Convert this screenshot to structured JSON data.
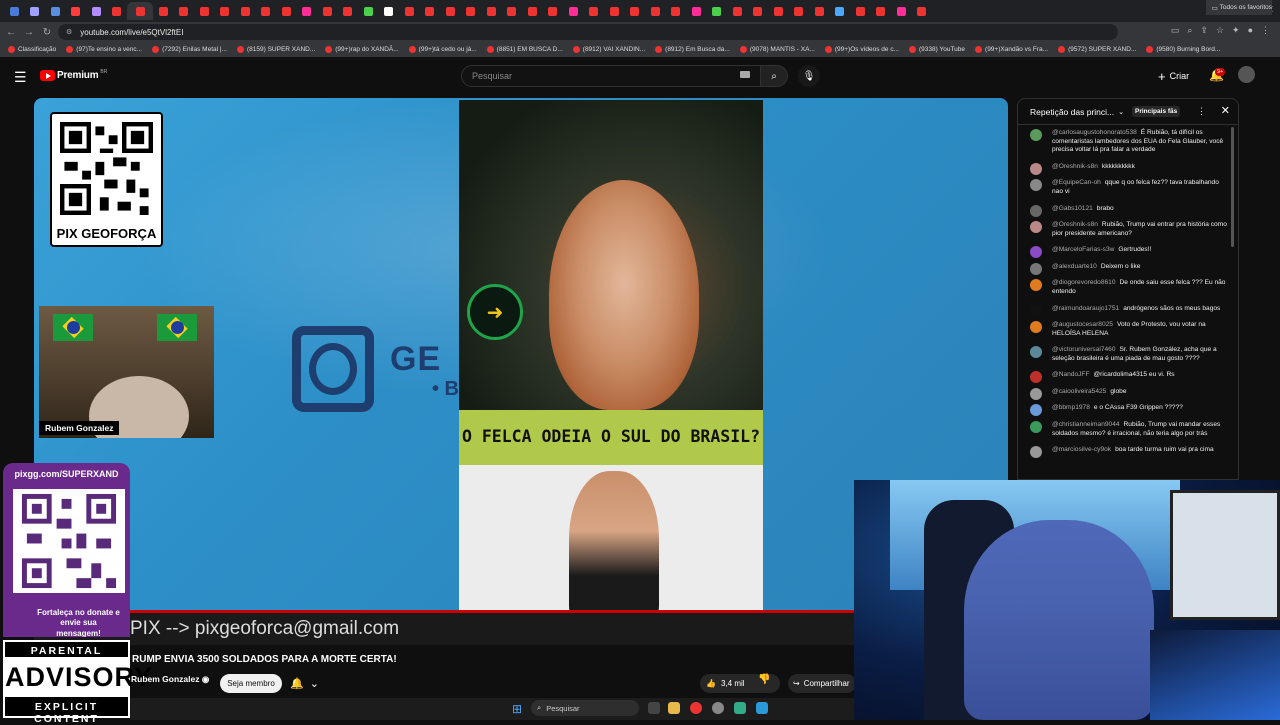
{
  "browser": {
    "url": "youtube.com/live/e5QtVl2ftEI",
    "tab_colors": [
      "#4a7bd8",
      "#a0a0ff",
      "#5a8ee0",
      "#ff3b3b",
      "#b38cff",
      "#e33",
      "#e33",
      "#e33",
      "#e33",
      "#e33",
      "#e33",
      "#e33",
      "#e33",
      "#e33",
      "#ff2d95",
      "#e33",
      "#e33",
      "#4ccf4c",
      "#ffffff",
      "#e33",
      "#e33",
      "#e33",
      "#e33",
      "#e33",
      "#e33",
      "#e33",
      "#e33",
      "#ff2d95",
      "#e33",
      "#e33",
      "#e33",
      "#e33",
      "#e33",
      "#ff2d95",
      "#4ccf4c",
      "#e33",
      "#e33",
      "#e33",
      "#e33",
      "#e33",
      "#4aa8ff",
      "#e33",
      "#e33",
      "#ff2d95",
      "#e33"
    ],
    "bookmarks": [
      "Classificação",
      "(97)Te ensino a venc...",
      "(7292) Enilas Metal |...",
      "(8159) SUPER XAND...",
      "(99+)rap do XANDÃ...",
      "(99+)tá cedo ou já...",
      "(8851) EM BUSCA D...",
      "(8912) VAI XANDIN...",
      "(8912) Em Busca da...",
      "(9078) MANTIS - XA...",
      "(99+)Os vídeos de c...",
      "(9338) YouTube",
      "(99+)Xandão vs Fra...",
      "(9572) SUPER XAND...",
      "(9580) Burning Bord..."
    ],
    "bookmarks_all": "Todos os favoritos"
  },
  "header": {
    "logo_text": "Premium",
    "logo_region": "BR",
    "search_placeholder": "Pesquisar",
    "create_label": "Criar",
    "notif_count": "9+"
  },
  "player": {
    "qr_caption": "PIX GEOFORÇA",
    "brand_text": "GE",
    "brand_sub": "• B",
    "webcam_name": "Rubem Gonzalez",
    "video_caption": "O FELCA ODEIA O SUL DO BRASIL?",
    "pix_line": "PIX --> pixgeoforca@gmail.com",
    "pix_line_prefix": "PIX"
  },
  "donate": {
    "url": "pixgg.com/SUPERXAND",
    "message": "Fortaleça no donate e envie sua mensagem!"
  },
  "advisory": {
    "top": "PARENTAL",
    "middle": "ADVISORY",
    "bottom": "EXPLICIT CONTENT"
  },
  "video": {
    "title": "RUMP ENVIA 3500 SOLDADOS PARA A MORTE CERTA!",
    "channel": "Rubem Gonzalez",
    "join_label": "Seja membro",
    "likes": "3,4 mil",
    "share_label": "Compartilhar"
  },
  "chat": {
    "title": "Repetição das princi...",
    "tag": "Principais fãs",
    "messages": [
      {
        "user": "@carlosaugustohonorato538",
        "text": "É Rubião, tá difícil os comentaristas lambedores dos EUA do Fela Glauber, você precisa voltar lá pra falar a verdade",
        "color": "#5a9a5a"
      },
      {
        "user": "@Oreshnik-s8n",
        "text": "kkkkkkkkkk",
        "color": "#b88"
      },
      {
        "user": "@EquipeCan-oh",
        "text": "qque q oo felca fez?? tava trabalhando nao vi",
        "color": "#888"
      },
      {
        "user": "@Gabs10121",
        "text": "brabo",
        "color": "#666"
      },
      {
        "user": "@Oreshnik-s8n",
        "text": "Rubião, Trump vai entrar pra história como pior presidente americano?",
        "color": "#b88"
      },
      {
        "user": "@MarceloFarias-s3w",
        "text": "Gertrudes!!",
        "color": "#8b4bc8"
      },
      {
        "user": "@alexduarte10",
        "text": "Deixem o like",
        "color": "#777"
      },
      {
        "user": "@diogorevoredo8610",
        "text": "De onde saiu esse felca ??? Eu não entendo",
        "color": "#e07b20"
      },
      {
        "user": "@raimundoaraujo1751",
        "text": "andrógenos sãos os meus bagos",
        "color": "#111"
      },
      {
        "user": "@augustocesar8025",
        "text": "Voto de Protesto, vou votar na HELOÍSA HELENA",
        "color": "#e07b20"
      },
      {
        "user": "@victoruniversal7460",
        "text": "Sr. Rubem González, acha que a seleção brasileira é uma piada de mau gosto ????",
        "color": "#5a8a9a"
      },
      {
        "user": "@NandoJFF",
        "text": "@ricardolima4315 eu vi. Rs",
        "color": "#c0302a"
      },
      {
        "user": "@caiooliveira5425",
        "text": "globe",
        "color": "#999"
      },
      {
        "user": "@bbmp1978",
        "text": "e o CAssa F39 Grippen ?????",
        "color": "#6a9ad8"
      },
      {
        "user": "@christianneiman9044",
        "text": "Rubião, Trump vai mandar esses soldados mesmo? é irracional, não teria algo por trás",
        "color": "#3a9a5a"
      },
      {
        "user": "@marciosilve-cy9ok",
        "text": "boa tarde turma ruim vai pra cima",
        "color": "#999"
      }
    ]
  },
  "taskbar": {
    "search_label": "Pesquisar"
  },
  "colors": {
    "accent_red": "#ff0000",
    "progress": "#cc0000",
    "donate_purple": "#6a2a8c",
    "caption_green": "#b1c94a"
  }
}
